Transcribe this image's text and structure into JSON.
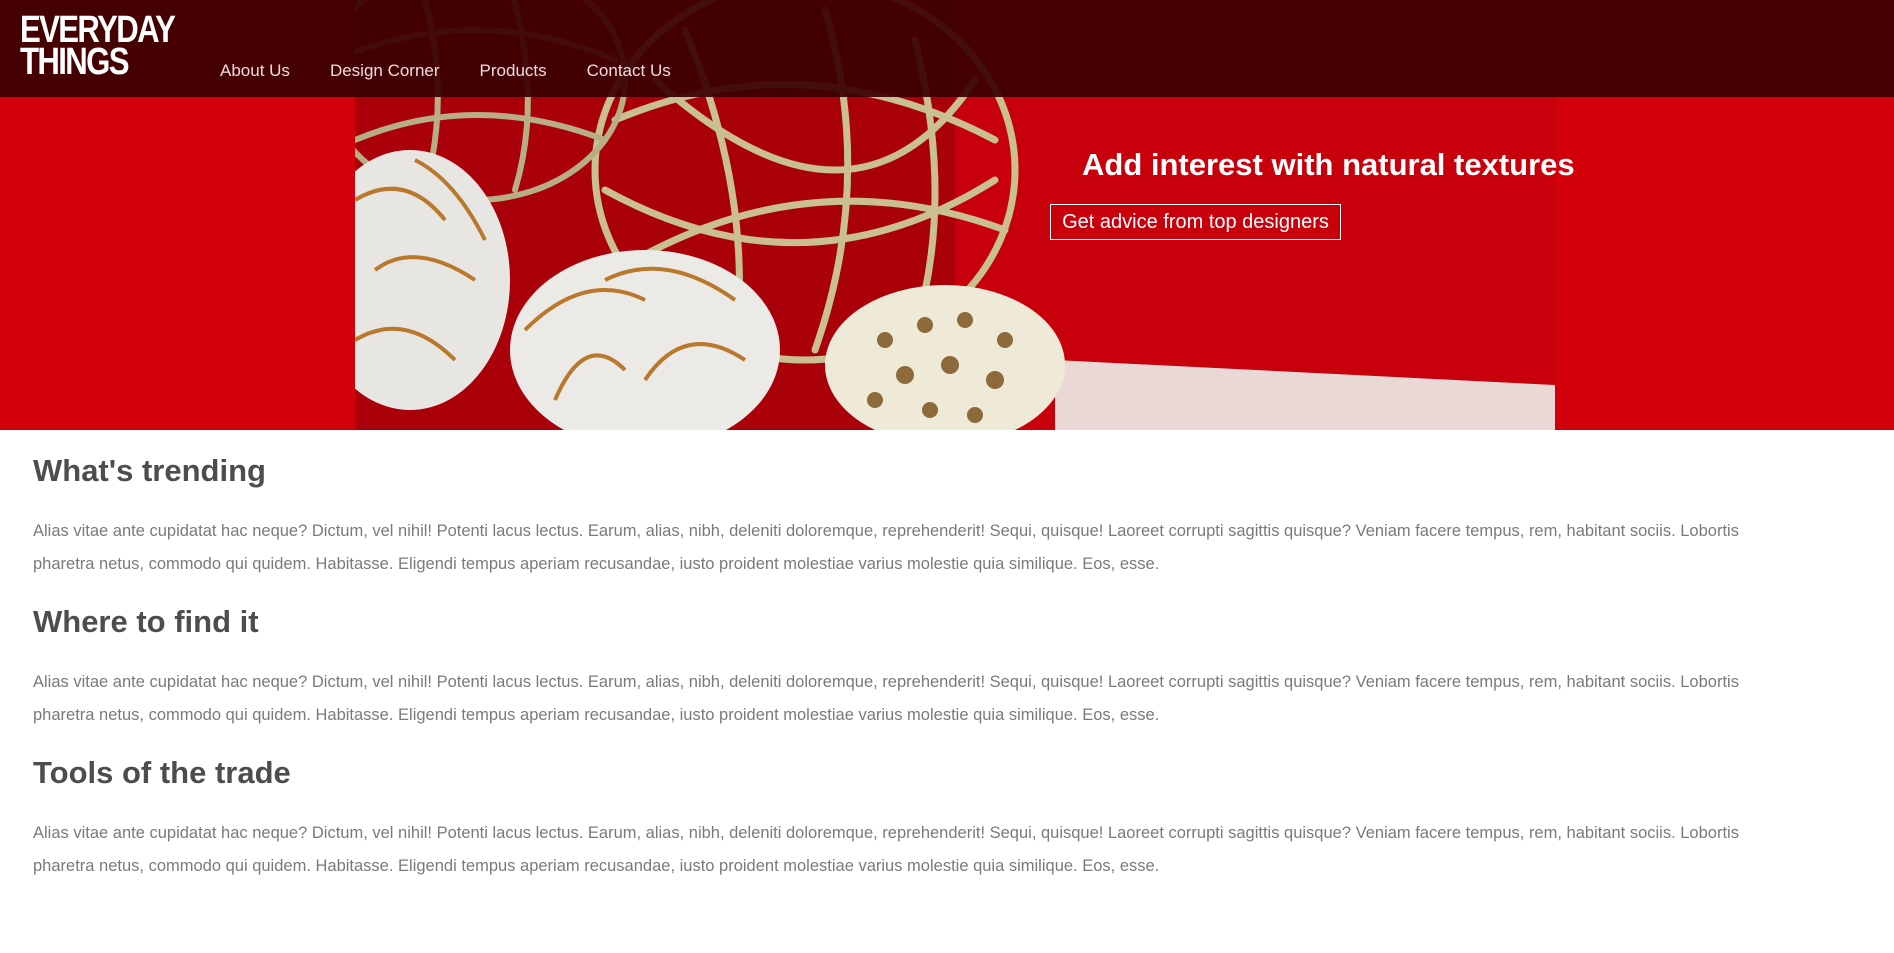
{
  "brand": {
    "line1": "EVERYDAY",
    "line2": "THINGS"
  },
  "nav": {
    "items": [
      {
        "label": "About Us"
      },
      {
        "label": "Design Corner"
      },
      {
        "label": "Products"
      },
      {
        "label": "Contact Us"
      }
    ]
  },
  "hero": {
    "title": "Add interest with natural textures",
    "cta_label": "Get advice from top designers"
  },
  "sections": [
    {
      "heading": "What's trending",
      "body": "Alias vitae ante cupidatat hac neque? Dictum, vel nihil! Potenti lacus lectus. Earum, alias, nibh, deleniti doloremque, reprehenderit! Sequi, quisque! Laoreet corrupti sagittis quisque? Veniam facere tempus, rem, habitant sociis. Lobortis pharetra netus, commodo qui quidem. Habitasse. Eligendi tempus aperiam recusandae, iusto proident molestiae varius molestie quia similique. Eos, esse."
    },
    {
      "heading": "Where to find it",
      "body": "Alias vitae ante cupidatat hac neque? Dictum, vel nihil! Potenti lacus lectus. Earum, alias, nibh, deleniti doloremque, reprehenderit! Sequi, quisque! Laoreet corrupti sagittis quisque? Veniam facere tempus, rem, habitant sociis. Lobortis pharetra netus, commodo qui quidem. Habitasse. Eligendi tempus aperiam recusandae, iusto proident molestiae varius molestie quia similique. Eos, esse."
    },
    {
      "heading": "Tools of the trade",
      "body": "Alias vitae ante cupidatat hac neque? Dictum, vel nihil! Potenti lacus lectus. Earum, alias, nibh, deleniti doloremque, reprehenderit! Sequi, quisque! Laoreet corrupti sagittis quisque? Veniam facere tempus, rem, habitant sociis. Lobortis pharetra netus, commodo qui quidem. Habitasse. Eligendi tempus aperiam recusandae, iusto proident molestiae varius molestie quia similique. Eos, esse."
    }
  ],
  "colors": {
    "accent_red": "#d2000a",
    "navbar_bg": "#3a0002",
    "heading_text": "#4d4d4d",
    "body_text": "#7a7a7a"
  }
}
